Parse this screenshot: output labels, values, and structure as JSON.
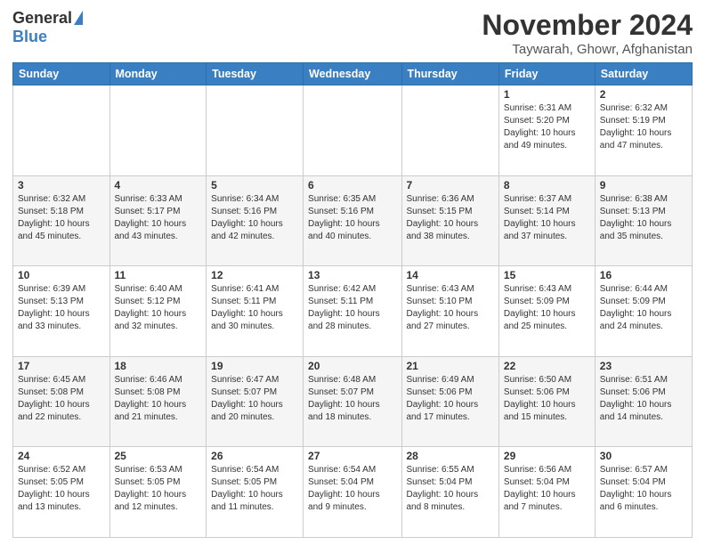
{
  "header": {
    "logo_general": "General",
    "logo_blue": "Blue",
    "title": "November 2024",
    "subtitle": "Taywarah, Ghowr, Afghanistan"
  },
  "columns": [
    "Sunday",
    "Monday",
    "Tuesday",
    "Wednesday",
    "Thursday",
    "Friday",
    "Saturday"
  ],
  "weeks": [
    [
      {
        "day": "",
        "info": ""
      },
      {
        "day": "",
        "info": ""
      },
      {
        "day": "",
        "info": ""
      },
      {
        "day": "",
        "info": ""
      },
      {
        "day": "",
        "info": ""
      },
      {
        "day": "1",
        "info": "Sunrise: 6:31 AM\nSunset: 5:20 PM\nDaylight: 10 hours\nand 49 minutes."
      },
      {
        "day": "2",
        "info": "Sunrise: 6:32 AM\nSunset: 5:19 PM\nDaylight: 10 hours\nand 47 minutes."
      }
    ],
    [
      {
        "day": "3",
        "info": "Sunrise: 6:32 AM\nSunset: 5:18 PM\nDaylight: 10 hours\nand 45 minutes."
      },
      {
        "day": "4",
        "info": "Sunrise: 6:33 AM\nSunset: 5:17 PM\nDaylight: 10 hours\nand 43 minutes."
      },
      {
        "day": "5",
        "info": "Sunrise: 6:34 AM\nSunset: 5:16 PM\nDaylight: 10 hours\nand 42 minutes."
      },
      {
        "day": "6",
        "info": "Sunrise: 6:35 AM\nSunset: 5:16 PM\nDaylight: 10 hours\nand 40 minutes."
      },
      {
        "day": "7",
        "info": "Sunrise: 6:36 AM\nSunset: 5:15 PM\nDaylight: 10 hours\nand 38 minutes."
      },
      {
        "day": "8",
        "info": "Sunrise: 6:37 AM\nSunset: 5:14 PM\nDaylight: 10 hours\nand 37 minutes."
      },
      {
        "day": "9",
        "info": "Sunrise: 6:38 AM\nSunset: 5:13 PM\nDaylight: 10 hours\nand 35 minutes."
      }
    ],
    [
      {
        "day": "10",
        "info": "Sunrise: 6:39 AM\nSunset: 5:13 PM\nDaylight: 10 hours\nand 33 minutes."
      },
      {
        "day": "11",
        "info": "Sunrise: 6:40 AM\nSunset: 5:12 PM\nDaylight: 10 hours\nand 32 minutes."
      },
      {
        "day": "12",
        "info": "Sunrise: 6:41 AM\nSunset: 5:11 PM\nDaylight: 10 hours\nand 30 minutes."
      },
      {
        "day": "13",
        "info": "Sunrise: 6:42 AM\nSunset: 5:11 PM\nDaylight: 10 hours\nand 28 minutes."
      },
      {
        "day": "14",
        "info": "Sunrise: 6:43 AM\nSunset: 5:10 PM\nDaylight: 10 hours\nand 27 minutes."
      },
      {
        "day": "15",
        "info": "Sunrise: 6:43 AM\nSunset: 5:09 PM\nDaylight: 10 hours\nand 25 minutes."
      },
      {
        "day": "16",
        "info": "Sunrise: 6:44 AM\nSunset: 5:09 PM\nDaylight: 10 hours\nand 24 minutes."
      }
    ],
    [
      {
        "day": "17",
        "info": "Sunrise: 6:45 AM\nSunset: 5:08 PM\nDaylight: 10 hours\nand 22 minutes."
      },
      {
        "day": "18",
        "info": "Sunrise: 6:46 AM\nSunset: 5:08 PM\nDaylight: 10 hours\nand 21 minutes."
      },
      {
        "day": "19",
        "info": "Sunrise: 6:47 AM\nSunset: 5:07 PM\nDaylight: 10 hours\nand 20 minutes."
      },
      {
        "day": "20",
        "info": "Sunrise: 6:48 AM\nSunset: 5:07 PM\nDaylight: 10 hours\nand 18 minutes."
      },
      {
        "day": "21",
        "info": "Sunrise: 6:49 AM\nSunset: 5:06 PM\nDaylight: 10 hours\nand 17 minutes."
      },
      {
        "day": "22",
        "info": "Sunrise: 6:50 AM\nSunset: 5:06 PM\nDaylight: 10 hours\nand 15 minutes."
      },
      {
        "day": "23",
        "info": "Sunrise: 6:51 AM\nSunset: 5:06 PM\nDaylight: 10 hours\nand 14 minutes."
      }
    ],
    [
      {
        "day": "24",
        "info": "Sunrise: 6:52 AM\nSunset: 5:05 PM\nDaylight: 10 hours\nand 13 minutes."
      },
      {
        "day": "25",
        "info": "Sunrise: 6:53 AM\nSunset: 5:05 PM\nDaylight: 10 hours\nand 12 minutes."
      },
      {
        "day": "26",
        "info": "Sunrise: 6:54 AM\nSunset: 5:05 PM\nDaylight: 10 hours\nand 11 minutes."
      },
      {
        "day": "27",
        "info": "Sunrise: 6:54 AM\nSunset: 5:04 PM\nDaylight: 10 hours\nand 9 minutes."
      },
      {
        "day": "28",
        "info": "Sunrise: 6:55 AM\nSunset: 5:04 PM\nDaylight: 10 hours\nand 8 minutes."
      },
      {
        "day": "29",
        "info": "Sunrise: 6:56 AM\nSunset: 5:04 PM\nDaylight: 10 hours\nand 7 minutes."
      },
      {
        "day": "30",
        "info": "Sunrise: 6:57 AM\nSunset: 5:04 PM\nDaylight: 10 hours\nand 6 minutes."
      }
    ]
  ]
}
